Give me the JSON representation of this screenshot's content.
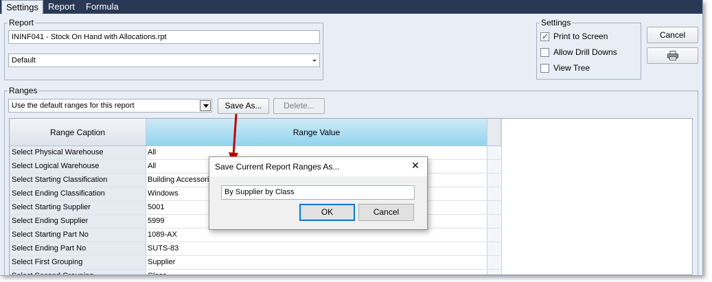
{
  "tabs": [
    {
      "label": "Settings",
      "active": true
    },
    {
      "label": "Report",
      "active": false
    },
    {
      "label": "Formula",
      "active": false
    }
  ],
  "report": {
    "legend": "Report",
    "file_value": "ININF041 - Stock On Hand with Allocations.rpt",
    "layout_value": "Default"
  },
  "settings": {
    "legend": "Settings",
    "options": [
      {
        "label": "Print to Screen",
        "checked": true
      },
      {
        "label": "Allow Drill Downs",
        "checked": false
      },
      {
        "label": "View Tree",
        "checked": false
      }
    ]
  },
  "actions": {
    "cancel_label": "Cancel",
    "print_icon": "printer-icon"
  },
  "ranges": {
    "legend": "Ranges",
    "preset_value": "Use the default ranges for this report",
    "save_as_label": "Save As...",
    "delete_label": "Delete..."
  },
  "grid": {
    "headers": [
      "Range Caption",
      "Range Value"
    ],
    "rows": [
      {
        "caption": "Select Physical Warehouse",
        "value": "All"
      },
      {
        "caption": "Select Logical Warehouse",
        "value": "All"
      },
      {
        "caption": "Select Starting Classification",
        "value": "Building Accessories"
      },
      {
        "caption": "Select Ending Classification",
        "value": "Windows"
      },
      {
        "caption": "Select Starting Supplier",
        "value": "5001"
      },
      {
        "caption": "Select Ending Supplier",
        "value": "5999"
      },
      {
        "caption": "Select Starting Part No",
        "value": "1089-AX"
      },
      {
        "caption": "Select Ending Part No",
        "value": "SUTS-83"
      },
      {
        "caption": "Select First Grouping",
        "value": "Supplier"
      },
      {
        "caption": "Select Second Grouping",
        "value": "Class"
      }
    ]
  },
  "dialog": {
    "title": "Save Current Report Ranges As...",
    "close_glyph": "✕",
    "input_value": "By Supplier by Class",
    "ok_label": "OK",
    "cancel_label": "Cancel"
  },
  "colors": {
    "tabbar": "#293955",
    "panel": "#e9eef6",
    "grid_value_header": "#92d4ee",
    "annotation_arrow": "#c00000"
  }
}
